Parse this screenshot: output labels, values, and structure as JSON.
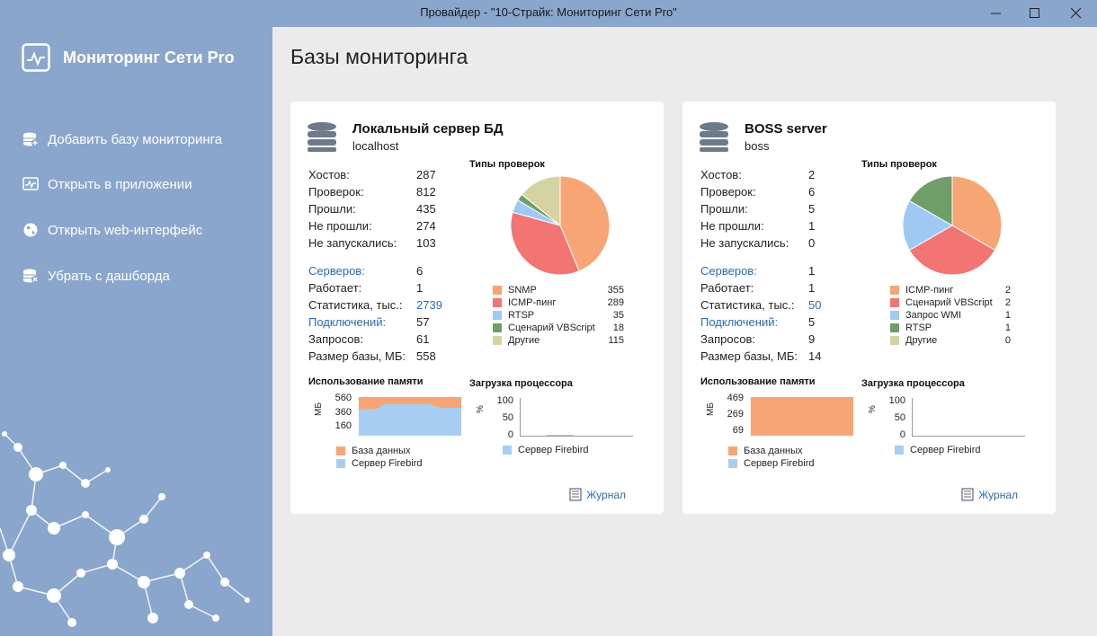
{
  "window": {
    "title": "Провайдер - \"10-Страйк: Мониторинг Сети Pro\""
  },
  "sidebar": {
    "brand": "Мониторинг Сети Pro",
    "items": [
      {
        "label": "Добавить базу мониторинга",
        "icon": "add-database-icon"
      },
      {
        "label": "Открыть в приложении",
        "icon": "monitor-chart-icon"
      },
      {
        "label": "Открыть web-интерфейс",
        "icon": "globe-icon"
      },
      {
        "label": "Убрать с дашборда",
        "icon": "remove-database-icon"
      }
    ]
  },
  "page": {
    "title": "Базы мониторинга"
  },
  "colors": {
    "snmp": "#f7a574",
    "icmp": "#f27473",
    "rtsp": "#9fc9f2",
    "vbscript": "#6f9e6a",
    "other": "#d6d3a2",
    "wmi": "#9fc9f2",
    "db_memory": "#f7a574",
    "firebird_memory": "#a8cdf2"
  },
  "cards": [
    {
      "title": "Локальный сервер БД",
      "subtitle": "localhost",
      "stats": [
        {
          "label": "Хостов:",
          "value": "287",
          "link": false
        },
        {
          "label": "Проверок:",
          "value": "812",
          "link": false
        },
        {
          "label": "Прошли:",
          "value": "435",
          "link": false
        },
        {
          "label": "Не прошли:",
          "value": "274",
          "link": false
        },
        {
          "label": "Не запускались:",
          "value": "103",
          "link": false
        }
      ],
      "stats2": [
        {
          "label": "Серверов:",
          "value": "6",
          "labelLink": true,
          "valueLink": false
        },
        {
          "label": "Работает:",
          "value": "1",
          "labelLink": false,
          "valueLink": false
        },
        {
          "label": "Статистика, тыс.:",
          "value": "2739",
          "labelLink": false,
          "valueLink": true
        },
        {
          "label": "Подключений:",
          "value": "57",
          "labelLink": true,
          "valueLink": false
        },
        {
          "label": "Запросов:",
          "value": "61",
          "labelLink": false,
          "valueLink": false
        },
        {
          "label": "Размер базы, МБ:",
          "value": "558",
          "labelLink": false,
          "valueLink": false
        }
      ],
      "checks_title": "Типы проверок",
      "memory_title": "Использование памяти",
      "cpu_title": "Загрузка процессора",
      "memory_unit": "МБ",
      "cpu_unit": "%",
      "memory_ticks": [
        "560",
        "360",
        "160"
      ],
      "cpu_ticks": [
        "100",
        "50",
        "0"
      ],
      "memory_legend": [
        "База данных",
        "Сервер Firebird"
      ],
      "cpu_legend": [
        "Сервер Firebird"
      ],
      "journal": "Журнал"
    },
    {
      "title": "BOSS server",
      "subtitle": "boss",
      "stats": [
        {
          "label": "Хостов:",
          "value": "2",
          "link": false
        },
        {
          "label": "Проверок:",
          "value": "6",
          "link": false
        },
        {
          "label": "Прошли:",
          "value": "5",
          "link": false
        },
        {
          "label": "Не прошли:",
          "value": "1",
          "link": false
        },
        {
          "label": "Не запускались:",
          "value": "0",
          "link": false
        }
      ],
      "stats2": [
        {
          "label": "Серверов:",
          "value": "1",
          "labelLink": true,
          "valueLink": false
        },
        {
          "label": "Работает:",
          "value": "1",
          "labelLink": false,
          "valueLink": false
        },
        {
          "label": "Статистика, тыс.:",
          "value": "50",
          "labelLink": false,
          "valueLink": true
        },
        {
          "label": "Подключений:",
          "value": "5",
          "labelLink": true,
          "valueLink": false
        },
        {
          "label": "Запросов:",
          "value": "9",
          "labelLink": false,
          "valueLink": false
        },
        {
          "label": "Размер базы, МБ:",
          "value": "14",
          "labelLink": false,
          "valueLink": false
        }
      ],
      "checks_title": "Типы проверок",
      "memory_title": "Использование памяти",
      "cpu_title": "Загрузка процессора",
      "memory_unit": "МБ",
      "cpu_unit": "%",
      "memory_ticks": [
        "469",
        "269",
        "69"
      ],
      "cpu_ticks": [
        "100",
        "50",
        "0"
      ],
      "memory_legend": [
        "База данных",
        "Сервер Firebird"
      ],
      "cpu_legend": [
        "Сервер Firebird"
      ],
      "journal": "Журнал"
    }
  ],
  "chart_data": [
    {
      "type": "pie",
      "title": "Типы проверок",
      "categories": [
        "SNMP",
        "ICMP-пинг",
        "RTSP",
        "Сценарий VBScript",
        "Другие"
      ],
      "values": [
        355,
        289,
        35,
        18,
        115
      ],
      "colors": [
        "#f7a574",
        "#f27473",
        "#9fc9f2",
        "#6f9e6a",
        "#d6d3a2"
      ]
    },
    {
      "type": "pie",
      "title": "Типы проверок",
      "categories": [
        "ICMP-пинг",
        "Сценарий VBScript",
        "Запрос WMI",
        "RTSP",
        "Другие"
      ],
      "values": [
        2,
        2,
        1,
        1,
        0
      ],
      "colors": [
        "#f7a574",
        "#f27473",
        "#9fc9f2",
        "#6f9e6a",
        "#d6d3a2"
      ]
    }
  ]
}
